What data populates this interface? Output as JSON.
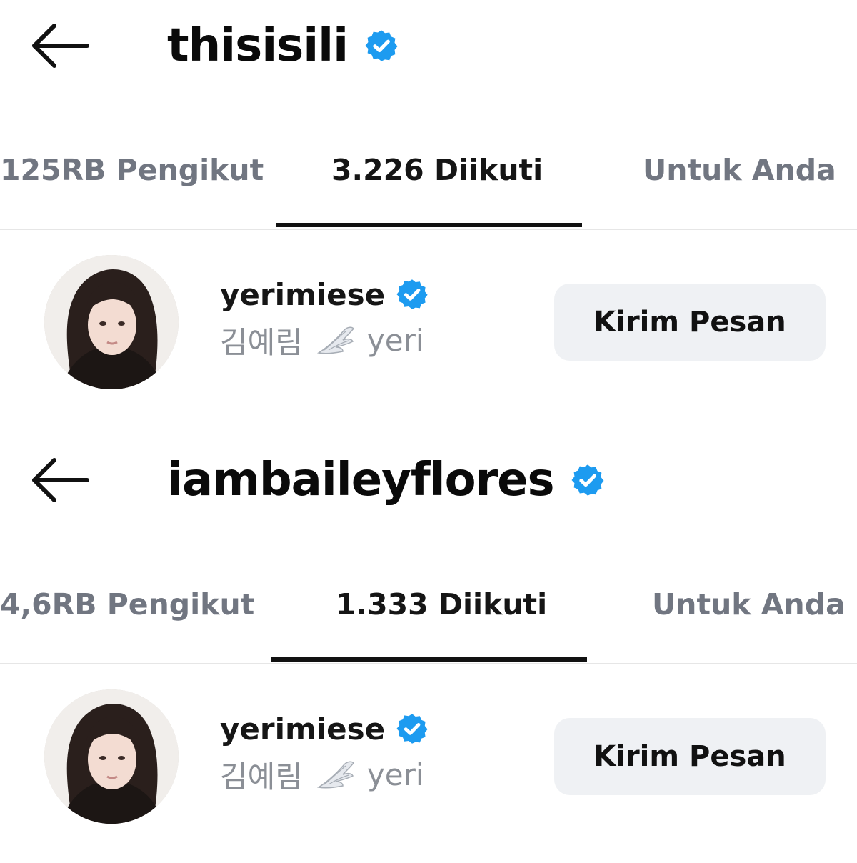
{
  "panels": [
    {
      "title": "thisisili",
      "verified": true,
      "tabs": [
        {
          "label": "125RB Pengikut",
          "active": false
        },
        {
          "label": "3.226 Diikuti",
          "active": true
        },
        {
          "label": "Untuk Anda",
          "active": false
        }
      ],
      "user": {
        "username": "yerimiese",
        "verified": true,
        "name_part1": "김예림",
        "name_icon": "wing-icon",
        "name_part2": "yeri",
        "button_label": "Kirim Pesan"
      }
    },
    {
      "title": "iambaileyflores",
      "verified": true,
      "tabs": [
        {
          "label": "4,6RB Pengikut",
          "active": false
        },
        {
          "label": "1.333 Diikuti",
          "active": true
        },
        {
          "label": "Untuk Anda",
          "active": false
        }
      ],
      "user": {
        "username": "yerimiese",
        "verified": true,
        "name_part1": "김예림",
        "name_icon": "wing-icon",
        "name_part2": "yeri",
        "button_label": "Kirim Pesan"
      }
    }
  ],
  "colors": {
    "verified_blue": "#1d9bf0",
    "tab_inactive": "#717681",
    "tab_active": "#151515",
    "button_bg": "#eff1f4",
    "subtext": "#8b8f96"
  }
}
